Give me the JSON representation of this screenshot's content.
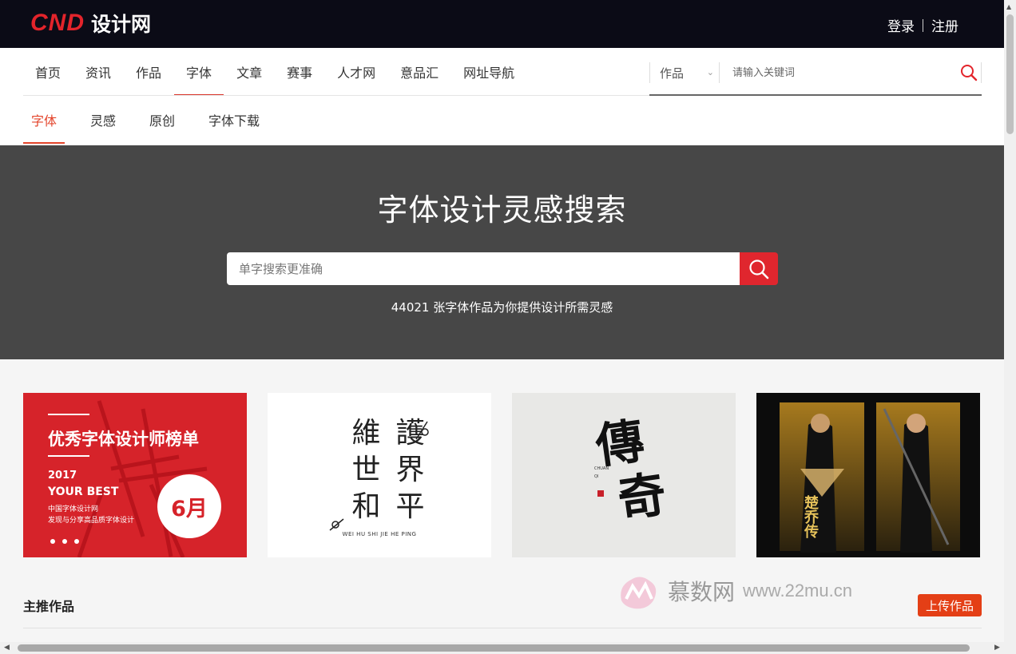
{
  "header": {
    "logo_mark": "CND",
    "logo_text": "设计网",
    "login": "登录",
    "register": "注册"
  },
  "main_nav": {
    "items": [
      "首页",
      "资讯",
      "作品",
      "字体",
      "文章",
      "赛事",
      "人才网",
      "意品汇",
      "网址导航"
    ],
    "active": "字体"
  },
  "search": {
    "category": "作品",
    "placeholder": "请输入关键词"
  },
  "sub_nav": {
    "items": [
      "字体",
      "灵感",
      "原创",
      "字体下载"
    ],
    "active": "字体"
  },
  "hero": {
    "title": "字体设计灵感搜索",
    "placeholder": "单字搜索更准确",
    "count_text": "44021 张字体作品为你提供设计所需灵感"
  },
  "cards": {
    "card1": {
      "title": "优秀字体设计师榜单",
      "year": "2017",
      "slogan": "YOUR BEST",
      "line1": "中国字体设计网",
      "line2": "发现与分享高品质字体设计",
      "month": "6月"
    },
    "card2": {
      "chars": [
        "維",
        "護",
        "世",
        "界",
        "和",
        "平"
      ],
      "pinyin": "WEI HU SHI JIE HE PING"
    },
    "card3": {
      "chars": [
        "傳",
        "奇"
      ],
      "pinyin": "CHUAN QI"
    },
    "card4": {
      "title_glyphs": "楚乔传"
    }
  },
  "section": {
    "title": "主推作品",
    "upload_button": "上传作品"
  },
  "watermark": {
    "name": "慕数网",
    "url": "www.22mu.cn"
  },
  "colors": {
    "brand_red": "#e3242b",
    "topbar": "#0b0b16",
    "hero_bg": "#474747",
    "upload": "#e43f16"
  }
}
